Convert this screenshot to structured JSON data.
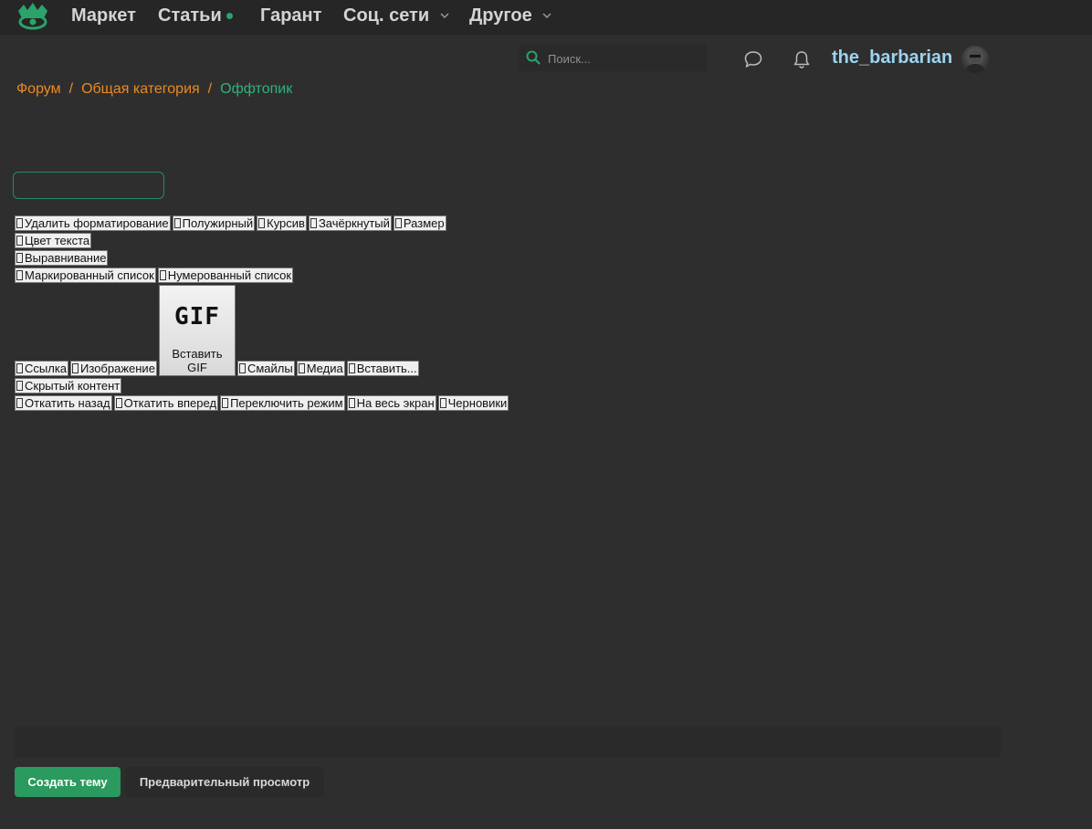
{
  "nav": {
    "items": [
      {
        "label": "Маркет"
      },
      {
        "label": "Статьи"
      },
      {
        "label": "Гарант"
      },
      {
        "label": "Соц. сети"
      },
      {
        "label": "Другое"
      }
    ]
  },
  "header": {
    "search_placeholder": "Поиск...",
    "username": "the_barbarian",
    "icons": [
      "search-icon",
      "chat-icon",
      "bell-icon"
    ]
  },
  "breadcrumb": {
    "items": [
      "Форум",
      "Общая категория",
      "Оффтопик"
    ],
    "separator": "/"
  },
  "toolbar": {
    "row1": [
      "Удалить форматирование",
      "Полужирный",
      "Курсив",
      "Зачёркнутый",
      "Размер"
    ],
    "row2": [
      "Цвет текста"
    ],
    "row3": [
      "Выравнивание"
    ],
    "row4": [
      "Маркированный список",
      "Нумерованный список"
    ],
    "row5_before": [
      "Ссылка",
      "Изображение"
    ],
    "gif_logo": "GIF",
    "gif_label": "Вставить GIF",
    "row5_after": [
      "Смайлы",
      "Медиа",
      "Вставить..."
    ],
    "row6": [
      "Скрытый контент"
    ],
    "row7": [
      "Откатить назад",
      "Откатить вперед",
      "Переключить режим",
      "На весь экран",
      "Черновики"
    ]
  },
  "actions": {
    "create_label": "Создать тему",
    "preview_label": "Предварительный просмотр"
  },
  "colors": {
    "accent_green": "#2a9a5e",
    "breadcrumb_orange": "#e98a24",
    "username_blue": "#9cd3f0"
  }
}
